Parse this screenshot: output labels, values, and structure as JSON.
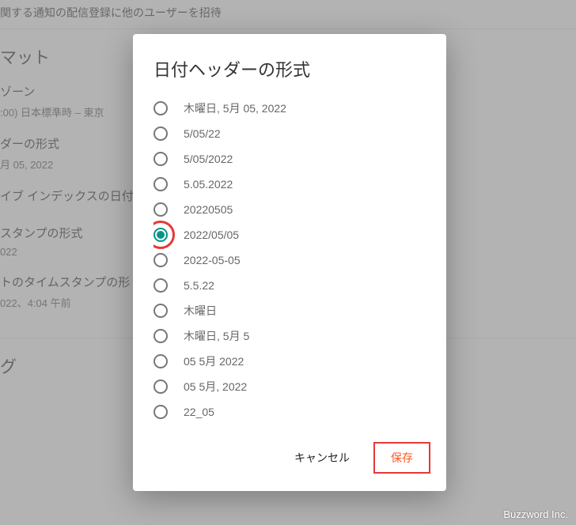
{
  "background": {
    "invite_text": "関する通知の配信登録に他のユーザーを招待",
    "section_format": "マット",
    "timezone_label": "ゾーン",
    "timezone_value": ":00) 日本標準時 – 東京",
    "date_header_label": "ダーの形式",
    "date_header_value": "月 05, 2022",
    "archive_index_label": "イブ インデックスの日付",
    "timestamp_label": "スタンプの形式",
    "timestamp_value": "022",
    "comment_timestamp_label": "トのタイムスタンプの形",
    "comment_timestamp_value": "022、4:04 午前",
    "section_tag": "グ"
  },
  "dialog": {
    "title": "日付ヘッダーの形式",
    "options": [
      {
        "label": "木曜日, 5月 05, 2022",
        "selected": false
      },
      {
        "label": "5/05/22",
        "selected": false
      },
      {
        "label": "5/05/2022",
        "selected": false
      },
      {
        "label": "5.05.2022",
        "selected": false
      },
      {
        "label": "20220505",
        "selected": false
      },
      {
        "label": "2022/05/05",
        "selected": true
      },
      {
        "label": "2022-05-05",
        "selected": false
      },
      {
        "label": "5.5.22",
        "selected": false
      },
      {
        "label": "木曜日",
        "selected": false
      },
      {
        "label": "木曜日, 5月 5",
        "selected": false
      },
      {
        "label": "05 5月 2022",
        "selected": false
      },
      {
        "label": "05 5月, 2022",
        "selected": false
      },
      {
        "label": "22_05",
        "selected": false
      }
    ],
    "cancel_label": "キャンセル",
    "save_label": "保存"
  },
  "watermark": "Buzzword Inc."
}
